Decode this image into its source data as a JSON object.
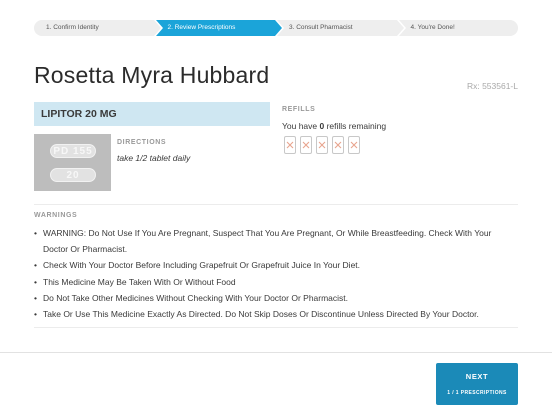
{
  "stepper": {
    "steps": [
      {
        "label": "1. Confirm Identity"
      },
      {
        "label": "2. Review Prescriptions"
      },
      {
        "label": "3. Consult Pharmacist"
      },
      {
        "label": "4. You're Done!"
      }
    ],
    "active_step": 2
  },
  "header": {
    "patient_name": "Rosetta Myra Hubbard",
    "rx_number": "Rx: 553561-L"
  },
  "drug": {
    "name": "LIPITOR 20 MG",
    "pill_imprint_top": "PD 155",
    "pill_imprint_bottom": "20",
    "directions_label": "DIRECTIONS",
    "directions_text": "take 1/2 tablet daily"
  },
  "refills": {
    "label": "REFILLS",
    "prefix": "You have ",
    "count": "0",
    "suffix": " refills remaining",
    "slots_total": 5,
    "slots_used": 5
  },
  "warnings": {
    "label": "WARNINGS",
    "items": [
      "WARNING: Do Not Use If You Are Pregnant, Suspect That You Are Pregnant, Or While Breastfeeding. Check With Your Doctor Or Pharmacist.",
      "Check With Your Doctor Before Including Grapefruit Or Grapefruit Juice In Your Diet.",
      "This Medicine May Be Taken With Or Without Food",
      "Do Not Take Other Medicines Without Checking With Your Doctor Or Pharmacist.",
      "Take Or Use This Medicine Exactly As Directed. Do Not Skip Doses Or Discontinue Unless Directed By Your Doctor."
    ]
  },
  "footer": {
    "next_label": "NEXT",
    "next_sub": "1 / 1 PRESCRIPTIONS"
  },
  "colors": {
    "accent": "#1ba4d9",
    "button": "#1b8ab8",
    "drug_header_bg": "#cfe7f2",
    "refill_x": "#e8a58f"
  }
}
